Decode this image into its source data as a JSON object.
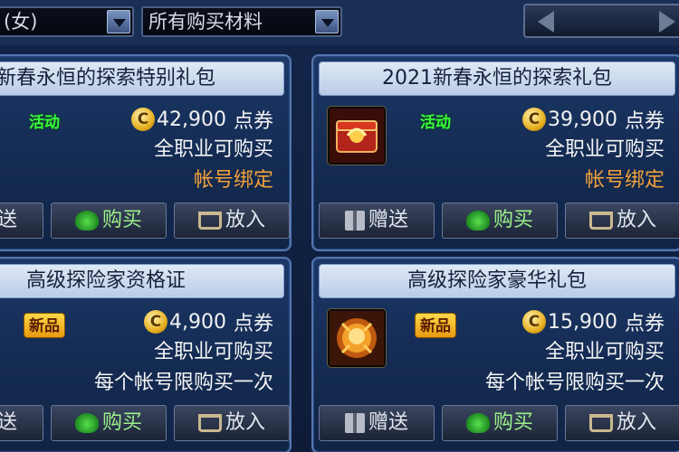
{
  "filters": {
    "gender_value": "(女)",
    "material_value": "所有购买材料"
  },
  "colors": {
    "card_bg": "#1c3868",
    "title_bar": "#dfe9f6",
    "price_orange": "#f2a13a",
    "event_green": "#39ff39",
    "buy_green": "#9cf08a"
  },
  "items": [
    {
      "title": "新春永恒的探索特别礼包",
      "badge": "活动",
      "coin_symbol": "C",
      "price": "42,900",
      "unit": "点券",
      "line1": "全职业可购买",
      "line2": "帐号绑定",
      "buttons": {
        "gift": "赠送",
        "buy": "购买",
        "cart": "放入"
      }
    },
    {
      "title": "2021新春永恒的探索礼包",
      "badge": "活动",
      "coin_symbol": "C",
      "price": "39,900",
      "unit": "点券",
      "line1": "全职业可购买",
      "line2": "帐号绑定",
      "icon": "gift-chest-icon",
      "buttons": {
        "gift": "赠送",
        "buy": "购买",
        "cart": "放入"
      }
    },
    {
      "title": "高级探险家资格证",
      "badge": "新品",
      "coin_symbol": "C",
      "price": "4,900",
      "unit": "点券",
      "line1": "全职业可购买",
      "line2": "每个帐号限购买一次",
      "buttons": {
        "gift": "赠送",
        "buy": "购买",
        "cart": "放入"
      }
    },
    {
      "title": "高级探险家豪华礼包",
      "badge": "新品",
      "coin_symbol": "C",
      "price": "15,900",
      "unit": "点券",
      "line1": "全职业可购买",
      "line2": "每个帐号限购买一次",
      "icon": "lion-emblem-icon",
      "buttons": {
        "gift": "赠送",
        "buy": "购买",
        "cart": "放入"
      }
    }
  ]
}
